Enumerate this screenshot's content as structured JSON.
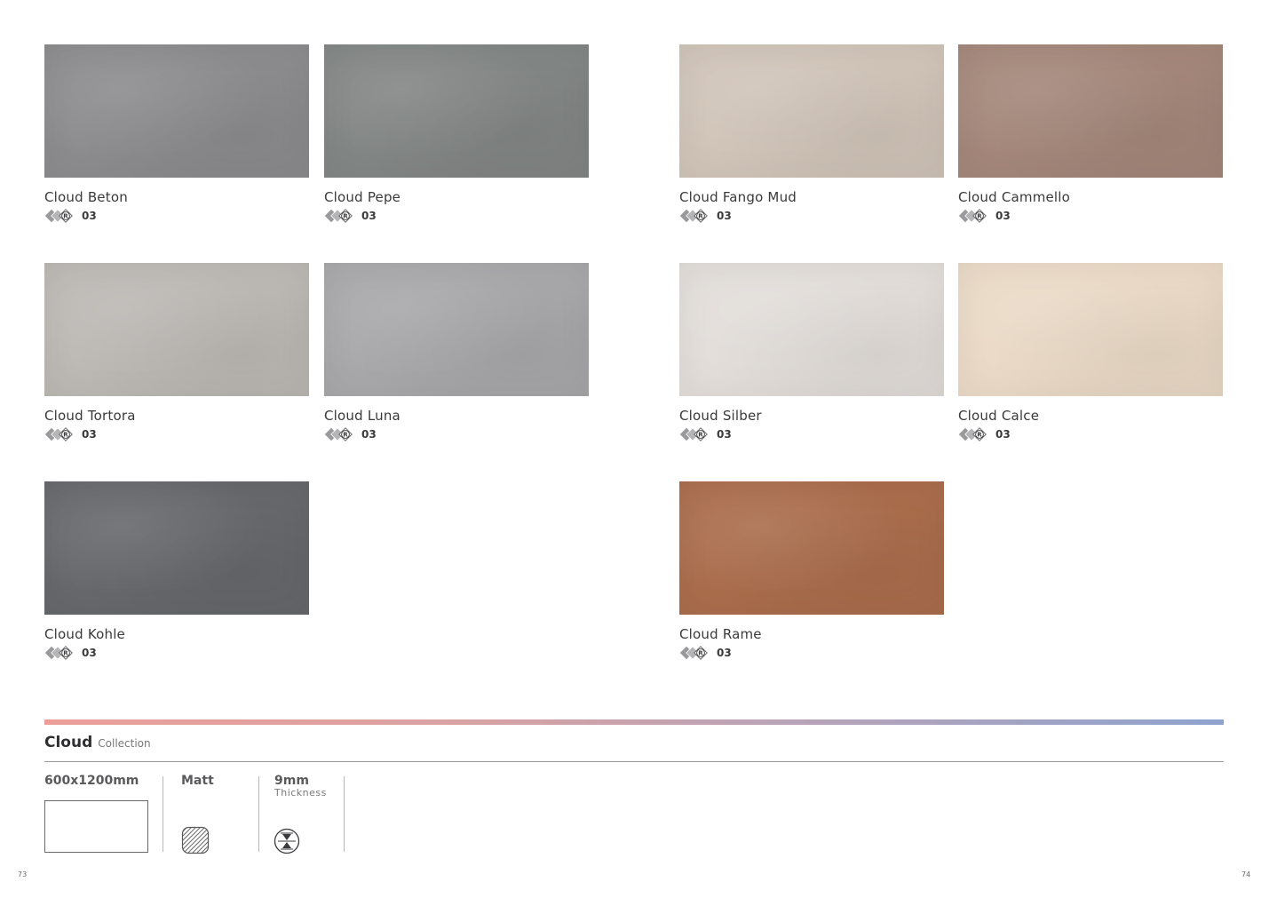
{
  "tiles": [
    {
      "name": "Cloud Beton",
      "rating": "03",
      "color": "#8c8c8e"
    },
    {
      "name": "Cloud Pepe",
      "rating": "03",
      "color": "#828684"
    },
    {
      "name": "Cloud Fango Mud",
      "rating": "03",
      "color": "#d0c4b8"
    },
    {
      "name": "Cloud Cammello",
      "rating": "03",
      "color": "#a4877a"
    },
    {
      "name": "Cloud Tortora",
      "rating": "03",
      "color": "#bcb8b4"
    },
    {
      "name": "Cloud Luna",
      "rating": "03",
      "color": "#a8a8aa"
    },
    {
      "name": "Cloud Silber",
      "rating": "03",
      "color": "#e2ddd9"
    },
    {
      "name": "Cloud Calce",
      "rating": "03",
      "color": "#ead9c6"
    },
    {
      "name": "Cloud Kohle",
      "rating": "03",
      "color": "#66686c"
    },
    {
      "name": "Cloud Rame",
      "rating": "03",
      "color": "#aa6d4c"
    }
  ],
  "collection": {
    "name": "Cloud",
    "subtitle": "Collection"
  },
  "specs": {
    "size": "600x1200mm",
    "finish": "Matt",
    "thickness": "9mm",
    "thickness_label": "Thickness"
  },
  "icons": {
    "slip": "slip-rating-icon",
    "finish": "matt-finish-icon",
    "thickness": "thickness-icon"
  },
  "accent_gradient": [
    "#ec9f99",
    "#8ea3cf"
  ],
  "pages": {
    "left": "73",
    "right": "74"
  }
}
